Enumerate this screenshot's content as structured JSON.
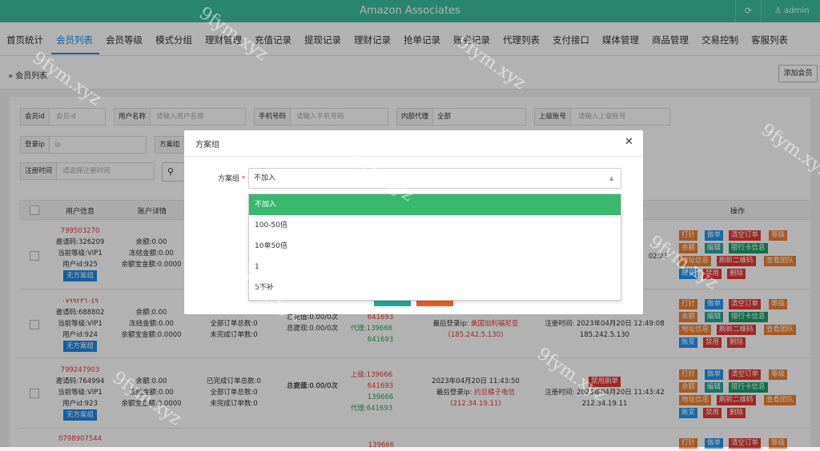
{
  "app": {
    "title": "Amazon Associates",
    "refresh_icon": "refresh-icon",
    "user_icon": "user-icon",
    "username": "admin"
  },
  "nav": {
    "tabs": [
      "首页统计",
      "会员列表",
      "会员等级",
      "模式分组",
      "理财管理",
      "充值记录",
      "提现记录",
      "理财记录",
      "抢单记录",
      "账变记录",
      "代理列表",
      "支付接口",
      "媒体管理",
      "商品管理",
      "交易控制",
      "客服列表"
    ],
    "active_index": 1
  },
  "breadcrumb": {
    "text": "会员列表",
    "add_button": "添加会员"
  },
  "filters": {
    "member_id": {
      "label": "会员id",
      "placeholder": "会员id"
    },
    "username": {
      "label": "用户名称",
      "placeholder": "请输入用户名称"
    },
    "phone": {
      "label": "手机号码",
      "placeholder": "请输入手机号码"
    },
    "agent": {
      "label": "内部代理",
      "value": "全部"
    },
    "parent": {
      "label": "上级账号",
      "placeholder": "请输入上级账号"
    },
    "login_ip": {
      "label": "登录ip",
      "placeholder": "ip"
    },
    "plan_group": {
      "label": "方案组"
    },
    "register_time": {
      "label": "注册时间",
      "placeholder": "请选择注册时间"
    }
  },
  "table": {
    "headers": {
      "user_info": "用户信息",
      "account": "账户详情",
      "operation": "操作"
    },
    "rows": [
      {
        "phone": "799503270",
        "invite": "邀请码:326209",
        "level": "当前等级:VIP1",
        "uid": "用户id:925",
        "group": "无方案组",
        "balance": "余额:0.00",
        "frozen": "冻结金额:0.00",
        "yeb": "余额宝金额:0.0000",
        "time_right": "02:23"
      },
      {
        "phone": "٠٧٩٩٢٣٦٠٤٩",
        "invite": "邀请码:688802",
        "level": "当前等级:VIP1",
        "uid": "用户id:924",
        "group": "无方案组",
        "balance": "余额:0.00",
        "frozen": "冻结金额:0.00",
        "yeb": "余额宝金额:0.0000",
        "orders_done": "全部订单总数:0",
        "orders_undone": "未完成订单数:0",
        "recharge": "总充值:0.00/0次",
        "withdraw": "总提现:0.00/0次",
        "up_num": "641693",
        "agent_label": "代理:",
        "agent_num1": "139666",
        "agent_num2": "641693",
        "last_ip_label": "最后登录ip:",
        "last_ip_loc": "美国加利福尼亚",
        "last_ip": "(185.242.5.130)",
        "reg": "注册时间: 2023年04月20日 12:49:08",
        "reg_ip": "185.242.5.130"
      },
      {
        "phone": "799247903",
        "invite": "邀请码:764994",
        "level": "当前等级:VIP1",
        "uid": "用户id:923",
        "group": "无方案组",
        "balance": "余额:0.00",
        "frozen": "冻结金额:0.00",
        "yeb": "余额宝金额:0.0000",
        "orders_completed": "已完成订单总数:0",
        "orders_done": "全部订单总数:0",
        "orders_undone": "未完成订单数:0",
        "recharge": "总充值:0.00/0次",
        "withdraw": "总提现:0.00/0次",
        "up_label": "上级:",
        "up_num1": "139666",
        "up_num2": "641693",
        "agent_label": "代理:",
        "agent_num1": "139666",
        "agent_num2": "641693",
        "last_time": "2023年04月20日 11:43:50",
        "last_ip_label": "最后登录ip:",
        "last_ip_loc": "约旦橘子电信",
        "last_ip": "(212.34.19.11)",
        "ban_tag": "禁用刷单",
        "reg": "注册时间: 2023年04月20日 11:43:42",
        "reg_ip": "212.34.19.11"
      },
      {
        "phone": "0798907544",
        "up_num1": "139666"
      }
    ],
    "ops": [
      "打针",
      "做单",
      "清空订单",
      "等级",
      "余额",
      "编辑",
      "银行卡信息",
      "地址信息",
      "刷新二维码",
      "查看团队",
      "账变",
      "禁用",
      "删除"
    ]
  },
  "modal": {
    "title": "方案组",
    "close_icon": "close-icon",
    "field_label": "方案组",
    "required": "*",
    "selected": "不加入",
    "options": [
      "不加入",
      "100-50倍",
      "10单50倍",
      "1",
      "5不补"
    ]
  },
  "watermark": "9fym.xyz"
}
